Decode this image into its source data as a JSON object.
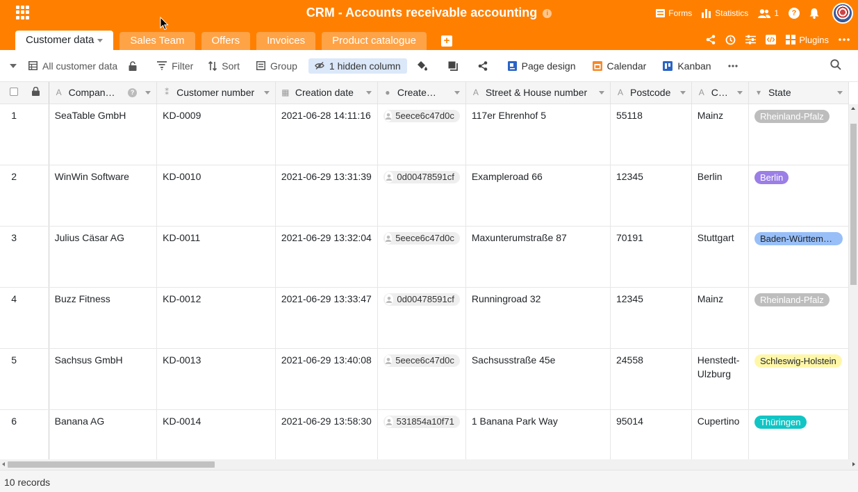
{
  "app": {
    "title": "CRM - Accounts receivable accounting",
    "forms_label": "Forms",
    "statistics_label": "Statistics",
    "collaborators_count": "1",
    "help_label": "?",
    "plugins_label": "Plugins"
  },
  "tabs": [
    {
      "label": "Customer data"
    },
    {
      "label": "Sales Team"
    },
    {
      "label": "Offers"
    },
    {
      "label": "Invoices"
    },
    {
      "label": "Product catalogue"
    }
  ],
  "toolbar": {
    "view_name": "All customer data",
    "filter_label": "Filter",
    "sort_label": "Sort",
    "group_label": "Group",
    "hidden_columns_label": "1 hidden column",
    "page_design_label": "Page design",
    "calendar_label": "Calendar",
    "kanban_label": "Kanban"
  },
  "columns": [
    {
      "label": "Compan…",
      "icon": "text-icon"
    },
    {
      "label": "Customer number",
      "icon": "autonumber-icon"
    },
    {
      "label": "Creation date",
      "icon": "date-icon"
    },
    {
      "label": "Create…",
      "icon": "creator-icon"
    },
    {
      "label": "Street & House number",
      "icon": "text-icon"
    },
    {
      "label": "Postcode",
      "icon": "text-icon"
    },
    {
      "label": "C…",
      "icon": "text-icon"
    },
    {
      "label": "State",
      "icon": "single-select-icon"
    }
  ],
  "rows": [
    {
      "num": "1",
      "company": "SeaTable GmbH",
      "customer_number": "KD-0009",
      "creation_date": "2021-06-28 14:11:16",
      "creator": "5eece6c47d0c",
      "street": "117er Ehrenhof 5",
      "postcode": "55118",
      "city": "Mainz",
      "state": "Rheinland-Pfalz",
      "state_bg": "#bdbdbd",
      "state_fg": "#ffffff"
    },
    {
      "num": "2",
      "company": "WinWin Software",
      "customer_number": "KD-0010",
      "creation_date": "2021-06-29 13:31:39",
      "creator": "0d00478591cf",
      "street": "Exampleroad 66",
      "postcode": "12345",
      "city": "Berlin",
      "state": "Berlin",
      "state_bg": "#9b7ee6",
      "state_fg": "#ffffff"
    },
    {
      "num": "3",
      "company": "Julius Cäsar AG",
      "customer_number": "KD-0011",
      "creation_date": "2021-06-29 13:32:04",
      "creator": "5eece6c47d0c",
      "street": "Maxunterumstraße 87",
      "postcode": "70191",
      "city": "Stuttgart",
      "state": "Baden-Württemberg",
      "state_bg": "#98bff7",
      "state_fg": "#212529"
    },
    {
      "num": "4",
      "company": "Buzz Fitness",
      "customer_number": "KD-0012",
      "creation_date": "2021-06-29 13:33:47",
      "creator": "0d00478591cf",
      "street": "Runningroad 32",
      "postcode": "12345",
      "city": "Mainz",
      "state": "Rheinland-Pfalz",
      "state_bg": "#bdbdbd",
      "state_fg": "#ffffff"
    },
    {
      "num": "5",
      "company": "Sachsus GmbH",
      "customer_number": "KD-0013",
      "creation_date": "2021-06-29 13:40:08",
      "creator": "5eece6c47d0c",
      "street": "Sachsusstraße 45e",
      "postcode": "24558",
      "city": "Henstedt-Ulzburg",
      "state": "Schleswig-Holstein",
      "state_bg": "#fff7a8",
      "state_fg": "#212529"
    },
    {
      "num": "6",
      "company": "Banana AG",
      "customer_number": "KD-0014",
      "creation_date": "2021-06-29 13:58:30",
      "creator": "531854a10f71",
      "street": "1 Banana Park Way",
      "postcode": "95014",
      "city": "Cupertino",
      "state": "Thüringen",
      "state_bg": "#11c5c5",
      "state_fg": "#ffffff"
    }
  ],
  "footer": {
    "records_label": "10 records"
  },
  "colors": {
    "brand": "#ff8000",
    "hidden_column_bg": "#dbe8f9"
  }
}
